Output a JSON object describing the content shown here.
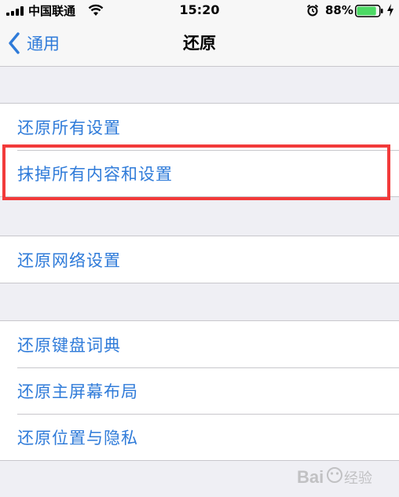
{
  "status_bar": {
    "carrier": "中国联通",
    "time": "15:20",
    "battery_percent": "88%",
    "battery_level": 0.88,
    "icons": [
      "signal-icon",
      "wifi-icon",
      "alarm-icon",
      "battery-icon",
      "charging-bolt-icon"
    ]
  },
  "nav": {
    "back_label": "通用",
    "title": "还原"
  },
  "groups": [
    {
      "items": [
        "还原所有设置",
        "抹掉所有内容和设置"
      ]
    },
    {
      "items": [
        "还原网络设置"
      ]
    },
    {
      "items": [
        "还原键盘词典",
        "还原主屏幕布局",
        "还原位置与隐私"
      ]
    }
  ],
  "highlighted_item": "抹掉所有内容和设置",
  "colors": {
    "accent": "#2f7bd9",
    "highlight": "#f23a3a",
    "background": "#efeff4",
    "battery_fill": "#4cd964"
  },
  "watermark": {
    "text": "Bai经验"
  }
}
